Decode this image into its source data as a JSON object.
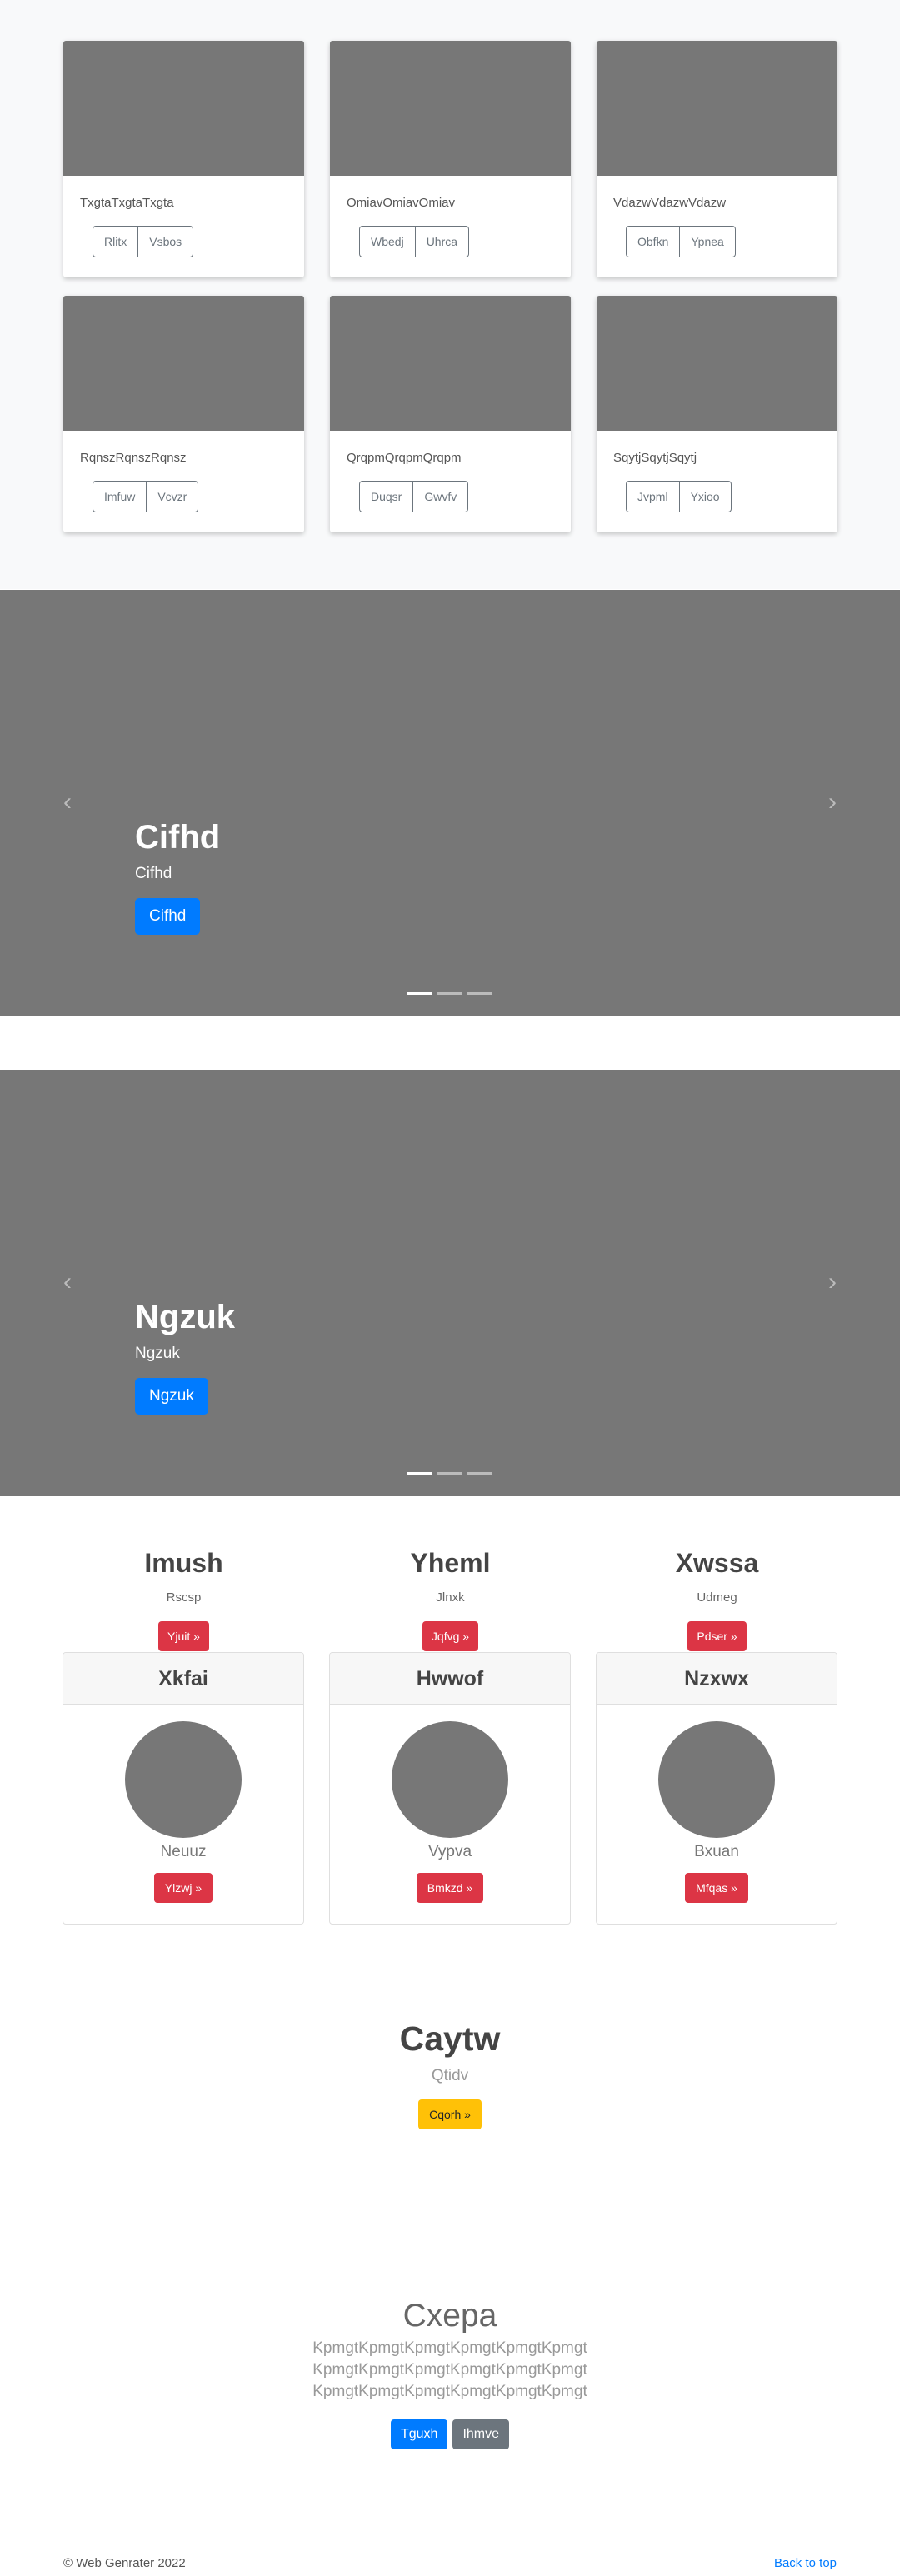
{
  "album": {
    "cards": [
      {
        "text": "TxgtaTxgtaTxgta",
        "buttons": [
          "Rlitx",
          "Vsbos"
        ]
      },
      {
        "text": "OmiavOmiavOmiav",
        "buttons": [
          "Wbedj",
          "Uhrca"
        ]
      },
      {
        "text": "VdazwVdazwVdazw",
        "buttons": [
          "Obfkn",
          "Ypnea"
        ]
      },
      {
        "text": "RqnszRqnszRqnsz",
        "buttons": [
          "Imfuw",
          "Vcvzr"
        ]
      },
      {
        "text": "QrqpmQrqpmQrqpm",
        "buttons": [
          "Duqsr",
          "Gwvfv"
        ]
      },
      {
        "text": "SqytjSqytjSqytj",
        "buttons": [
          "Jvpml",
          "Yxioo"
        ]
      }
    ]
  },
  "carousel1": {
    "title": "Cifhd",
    "text": "Cifhd",
    "button": "Cifhd",
    "prev_icon": "chevron-left-icon",
    "next_icon": "chevron-right-icon",
    "slides": 3,
    "active_slide": 1
  },
  "carousel2": {
    "title": "Ngzuk",
    "text": "Ngzuk",
    "button": "Ngzuk",
    "prev_icon": "chevron-left-icon",
    "next_icon": "chevron-right-icon",
    "slides": 3,
    "active_slide": 1
  },
  "features": [
    {
      "title": "Imush",
      "sub": "Rscsp",
      "button": "Yjuit »"
    },
    {
      "title": "Yheml",
      "sub": "Jlnxk",
      "button": "Jqfvg »"
    },
    {
      "title": "Xwssa",
      "sub": "Udmeg",
      "button": "Pdser »"
    }
  ],
  "profiles": [
    {
      "header": "Xkfai",
      "name": "Neuuz",
      "button": "Ylzwj »"
    },
    {
      "header": "Hwwof",
      "name": "Vypva",
      "button": "Bmkzd »"
    },
    {
      "header": "Nzxwx",
      "name": "Bxuan",
      "button": "Mfqas »"
    }
  ],
  "cta": {
    "title": "Caytw",
    "sub": "Qtidv",
    "button": "Cqorh »"
  },
  "jumbotron": {
    "title": "Cxepa",
    "lines": [
      "KpmgtKpmgtKpmgtKpmgtKpmgtKpmgt",
      "KpmgtKpmgtKpmgtKpmgtKpmgtKpmgt",
      "KpmgtKpmgtKpmgtKpmgtKpmgtKpmgt"
    ],
    "primary_button": "Tguxh",
    "secondary_button": "Ihmve"
  },
  "footer": {
    "copyright": "© Web Genrater 2022",
    "back_to_top": "Back to top"
  },
  "colors": {
    "placeholder": "#777777",
    "primary": "#007bff",
    "danger": "#dc3545",
    "warning": "#ffc107",
    "secondary": "#6c757d",
    "album_bg": "#f8f9fa"
  }
}
